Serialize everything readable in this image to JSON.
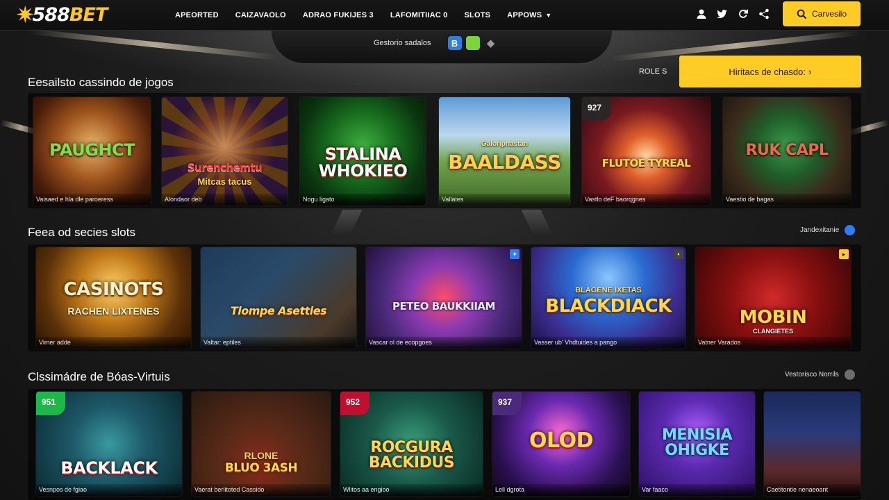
{
  "brand": {
    "logo_text": "588",
    "logo_text_accent": "BET"
  },
  "nav": {
    "items": [
      "APEORTED",
      "CAIZAVAOLO",
      "ADRAO FUKIJES 3",
      "LAFOMITIIAC 0",
      "SLOTS",
      "APPOWS"
    ]
  },
  "header": {
    "icons": [
      "user-icon",
      "twitter-icon",
      "refresh-icon",
      "share-icon"
    ],
    "search_button_label": "Carvesilo"
  },
  "providers": {
    "label": "Gestorio sadalos",
    "icons": [
      "b-logo",
      "green-app",
      "grey-diamond",
      "apple"
    ]
  },
  "colors": {
    "accent": "#ffcc26",
    "badge_green": "#1db84a",
    "dot_blue": "#2f7cf6",
    "dot_grey": "#6d6d6d"
  },
  "section1": {
    "title": "Eesailsto cassindo de jogos",
    "role_label": "ROLE S",
    "cta_label": "Hiritacs de chasdo:",
    "cards": [
      {
        "title": "PAUGHCT",
        "caption": "Vaisaed e hla dle paroeress"
      },
      {
        "title": "Surenchemtu",
        "sub": "Mitcas tacus",
        "caption": "Alondaor deb"
      },
      {
        "title": "STALINA WHOKIEO",
        "caption": "Nogu ligato"
      },
      {
        "title": "BAALDASS",
        "sub": "Galoripnastan",
        "caption": "Vallates"
      },
      {
        "title": "FLUTOE TYREAL",
        "badge": "927",
        "caption": "Vastlo deF baorqgnes"
      },
      {
        "title": "RUK CAPL",
        "caption": "Vaestio de bagas"
      }
    ]
  },
  "section2": {
    "title": "Feea od secies slots",
    "aux_label": "Jandexitanie",
    "cards": [
      {
        "title": "CASINOTS",
        "sub": "RACHEN LIXTENES",
        "caption": "Vimer adde"
      },
      {
        "title": "Tlompe Asetties",
        "caption": "Valtar: eptiles"
      },
      {
        "title": "PETEO BAUKKIIAM",
        "caption": "Vascar ol de ecopgoes"
      },
      {
        "title": "BLACKDIACK",
        "sub": "BLAGENE IXETAS",
        "caption": "Vasser ub' Vhdtuides a pango"
      },
      {
        "title": "MOBIN",
        "sub": "CLANGIETES",
        "caption": "Vatner Varados"
      }
    ]
  },
  "section3": {
    "title": "Clssimádre de Bóas-Virtuis",
    "aux_label": "Vestorisco Norrils",
    "cards": [
      {
        "title": "BACKLACK",
        "badge": "951",
        "caption": "Vesnpos de fgiao"
      },
      {
        "title": "BLUO 3ASH",
        "sub": "RLONE",
        "caption": "Vaerat berlitoted Cassido"
      },
      {
        "title": "ROCGURA BACKIDUS",
        "badge": "952",
        "caption": "Wlitos aa engioo"
      },
      {
        "title": "OLOD",
        "badge": "937",
        "caption": "Lell dgrota"
      },
      {
        "title": "MENISIA OHIGKE",
        "caption": "Var faaco"
      },
      {
        "title": "",
        "caption": "Caetitontie nenaeoant"
      }
    ]
  }
}
